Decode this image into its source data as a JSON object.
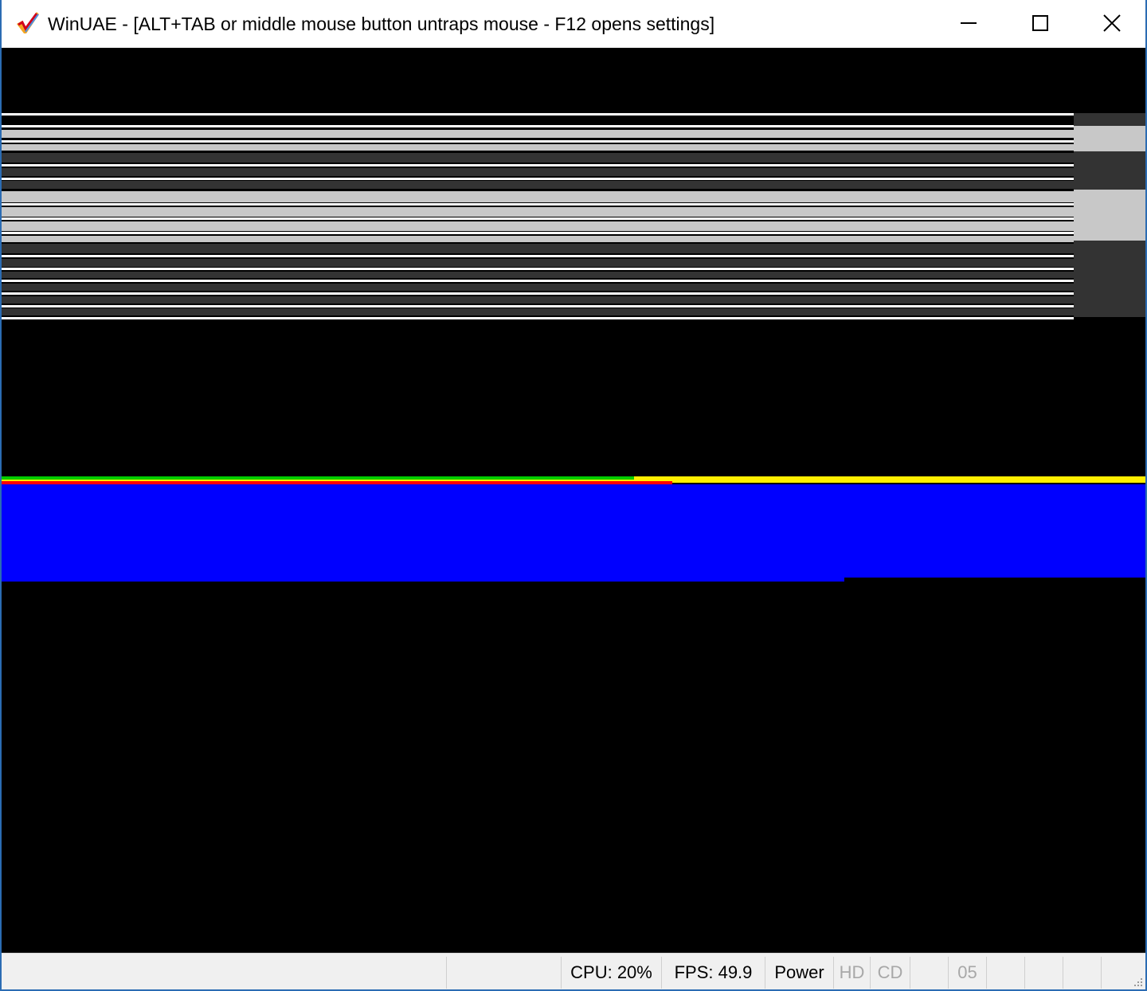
{
  "window": {
    "title": "WinUAE - [ALT+TAB or middle mouse button untraps mouse - F12 opens settings]",
    "icons": {
      "app": "checkmark-icon",
      "minimize": "minimize-icon",
      "maximize": "maximize-icon",
      "close": "close-icon"
    }
  },
  "colors": {
    "border": "#2b6cb3",
    "white_line": "#ffffff",
    "light_gray": "#c8c8c8",
    "dark_gray": "#333333",
    "green": "#00cc00",
    "red": "#ff0000",
    "yellow": "#ffee00",
    "blue": "#0000ff"
  },
  "statusbar": {
    "cpu": "CPU: 20%",
    "fps": "FPS: 49.9",
    "power": "Power",
    "hd": "HD",
    "cd": "CD",
    "drive": "05"
  }
}
